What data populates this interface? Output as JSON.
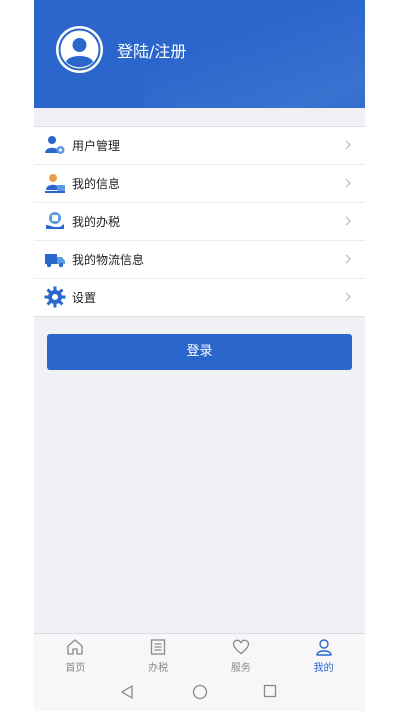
{
  "header": {
    "title": "登陆/注册"
  },
  "menu": [
    {
      "label": "用户管理",
      "icon": "user-settings-icon"
    },
    {
      "label": "我的信息",
      "icon": "profile-info-icon"
    },
    {
      "label": "我的办税",
      "icon": "tax-hand-icon"
    },
    {
      "label": "我的物流信息",
      "icon": "truck-icon"
    },
    {
      "label": "设置",
      "icon": "gear-icon"
    }
  ],
  "login_button": "登录",
  "tabs": [
    {
      "label": "首页",
      "icon": "home-icon"
    },
    {
      "label": "办税",
      "icon": "document-list-icon"
    },
    {
      "label": "服务",
      "icon": "heart-icon"
    },
    {
      "label": "我的",
      "icon": "person-icon",
      "active": true
    }
  ],
  "colors": {
    "brand": "#2a66cc",
    "background": "#f0f0f5",
    "inactive": "#8a8a8e"
  }
}
